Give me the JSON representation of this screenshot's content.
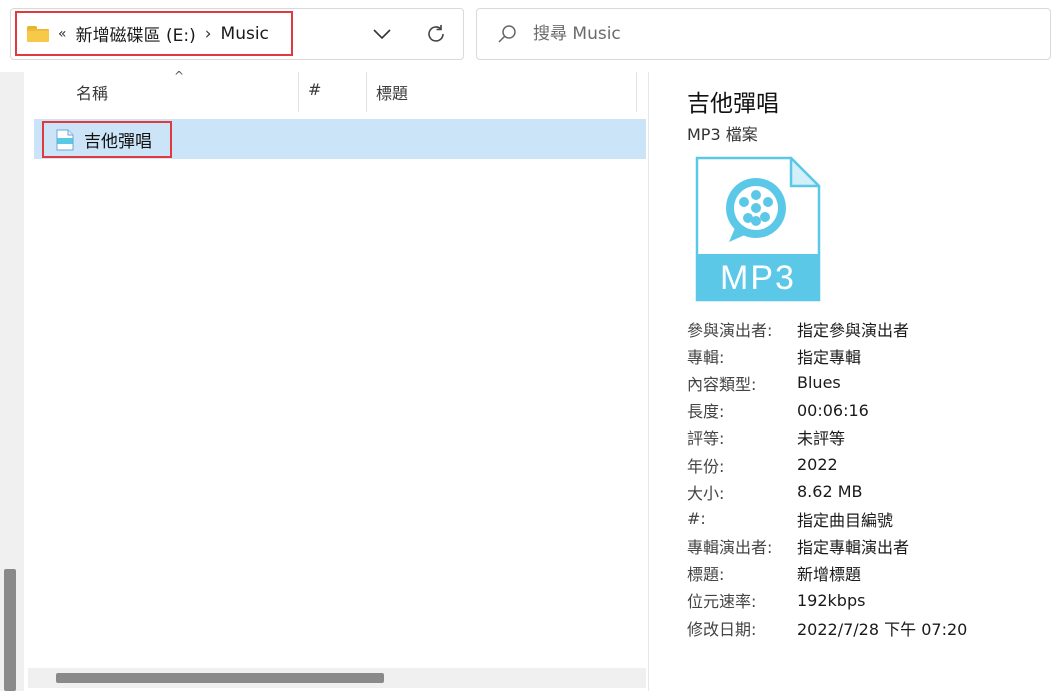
{
  "address": {
    "overflow_glyph": "«",
    "drive": "新增磁碟區 (E:)",
    "separator": "›",
    "folder": "Music"
  },
  "search": {
    "placeholder": "搜尋 Music"
  },
  "columns": [
    {
      "label": "名稱"
    },
    {
      "label": "#"
    },
    {
      "label": "標題"
    }
  ],
  "files": [
    {
      "name": "吉他彈唱",
      "selected": true
    }
  ],
  "details": {
    "title": "吉他彈唱",
    "type": "MP3 檔案",
    "icon_label": "MP3",
    "properties": [
      {
        "key": "參與演出者:",
        "value": "指定參與演出者"
      },
      {
        "key": "專輯:",
        "value": "指定專輯"
      },
      {
        "key": "內容類型:",
        "value": "Blues"
      },
      {
        "key": "長度:",
        "value": "00:06:16"
      },
      {
        "key": "評等:",
        "value": "未評等"
      },
      {
        "key": "年份:",
        "value": "2022"
      },
      {
        "key": "大小:",
        "value": "8.62 MB"
      },
      {
        "key": "#:",
        "value": "指定曲目編號"
      },
      {
        "key": "專輯演出者:",
        "value": "指定專輯演出者"
      },
      {
        "key": "標題:",
        "value": "新增標題"
      },
      {
        "key": "位元速率:",
        "value": "192kbps"
      },
      {
        "key": "修改日期:",
        "value": "2022/7/28 下午 07:20"
      }
    ]
  },
  "colors": {
    "highlight": "#e0393e",
    "selection": "#cce4f7",
    "mp3_accent": "#5bc8e8",
    "folder": "#f7c948"
  },
  "icons": [
    "folder-icon",
    "chevron-down-icon",
    "refresh-icon",
    "search-icon",
    "mp3-file-icon"
  ]
}
